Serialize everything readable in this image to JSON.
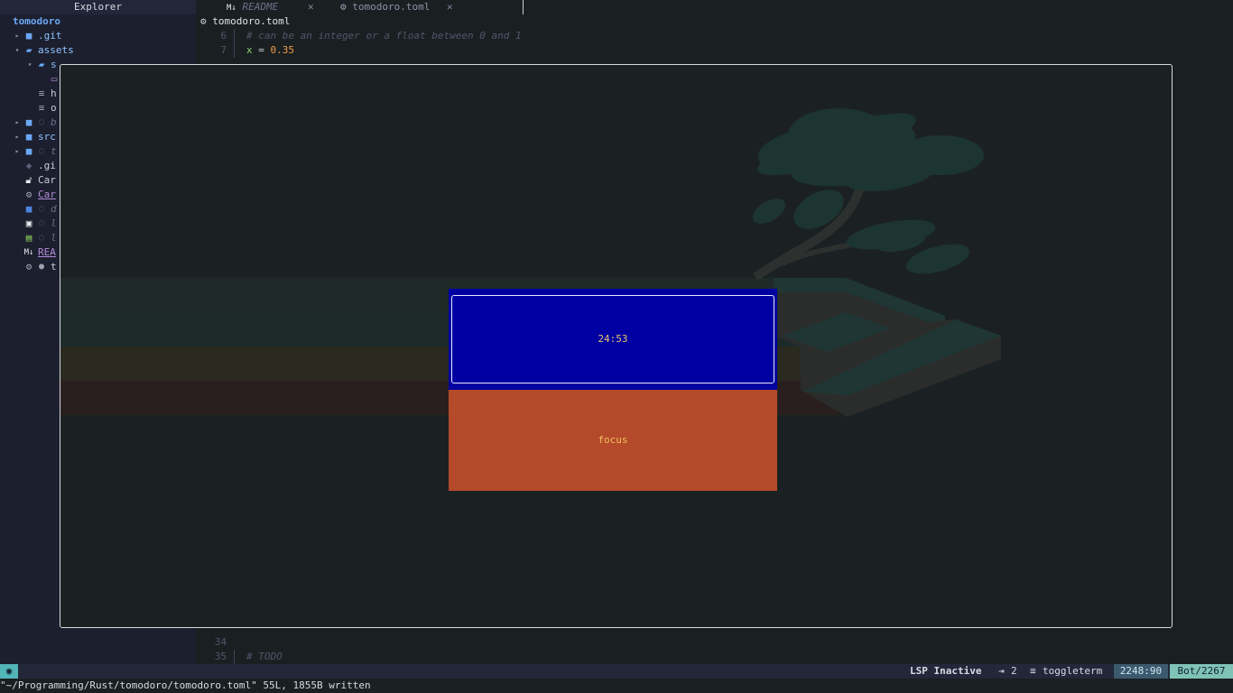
{
  "explorer": {
    "title": "Explorer",
    "root": "tomodoro",
    "rows": [
      {
        "arrow": "▸",
        "icon": "folder-icon",
        "label": ".git"
      },
      {
        "arrow": "▾",
        "icon": "folder-open-icon",
        "label": "assets"
      },
      {
        "arrow": "▾",
        "icon": "folder-open-icon",
        "label": "s"
      },
      {
        "arrow": "",
        "icon": "image-icon",
        "label": ""
      },
      {
        "arrow": "",
        "icon": "file-lines-icon",
        "label": "h"
      },
      {
        "arrow": "",
        "icon": "file-lines-icon",
        "label": "o"
      },
      {
        "arrow": "▸",
        "icon": "folder-icon",
        "git": "◌",
        "label": "b"
      },
      {
        "arrow": "▸",
        "icon": "folder-icon",
        "label": "src"
      },
      {
        "arrow": "▸",
        "icon": "folder-icon",
        "git": "◌",
        "label": "t"
      },
      {
        "arrow": "",
        "icon": "git-icon",
        "label": ".gi"
      },
      {
        "arrow": "",
        "icon": "lock-icon",
        "label": "Car"
      },
      {
        "arrow": "",
        "icon": "gear-icon",
        "label": "Car"
      },
      {
        "arrow": "",
        "icon": "docker-icon",
        "git": "◌",
        "label": "d"
      },
      {
        "arrow": "",
        "icon": "package-icon",
        "git": "◌",
        "label": "l"
      },
      {
        "arrow": "",
        "icon": "license-icon",
        "git": "◌",
        "label": "l"
      },
      {
        "arrow": "",
        "icon": "markdown-icon",
        "label": "REA"
      },
      {
        "arrow": "",
        "icon": "gear-icon",
        "git": "●",
        "label": "t"
      }
    ]
  },
  "tabs": [
    {
      "icon": "markdown-icon",
      "label": "README",
      "close": "✕"
    },
    {
      "icon": "gear-icon",
      "label": "tomodoro.toml",
      "close": "✕"
    }
  ],
  "winbar": {
    "icon": "gear-icon",
    "label": "tomodoro.toml"
  },
  "editor": {
    "top_lines": [
      {
        "num": "6",
        "text": "# can be an integer or a float between 0 and 1"
      },
      {
        "num": "7",
        "key": "x",
        "op": " = ",
        "value": "0.35"
      }
    ],
    "bottom_lines": [
      {
        "num": "34",
        "text": ""
      },
      {
        "num": "35",
        "text": "# TODO"
      }
    ]
  },
  "tomodoro": {
    "timer": "24:53",
    "mode": "focus",
    "colors": {
      "timer_bg": "#0000a2",
      "mode_bg": "#b54a2a",
      "text": "#e8c070"
    }
  },
  "statusline": {
    "mode_icon": "◉",
    "lsp": "LSP Inactive",
    "indent_icon": "⇥",
    "indent": "2",
    "term_icon": "≡",
    "term": "toggleterm",
    "position": "2248:90",
    "percent": "Bot/2267"
  },
  "cmdline": "\"~/Programming/Rust/tomodoro/tomodoro.toml\" 55L, 1855B written"
}
